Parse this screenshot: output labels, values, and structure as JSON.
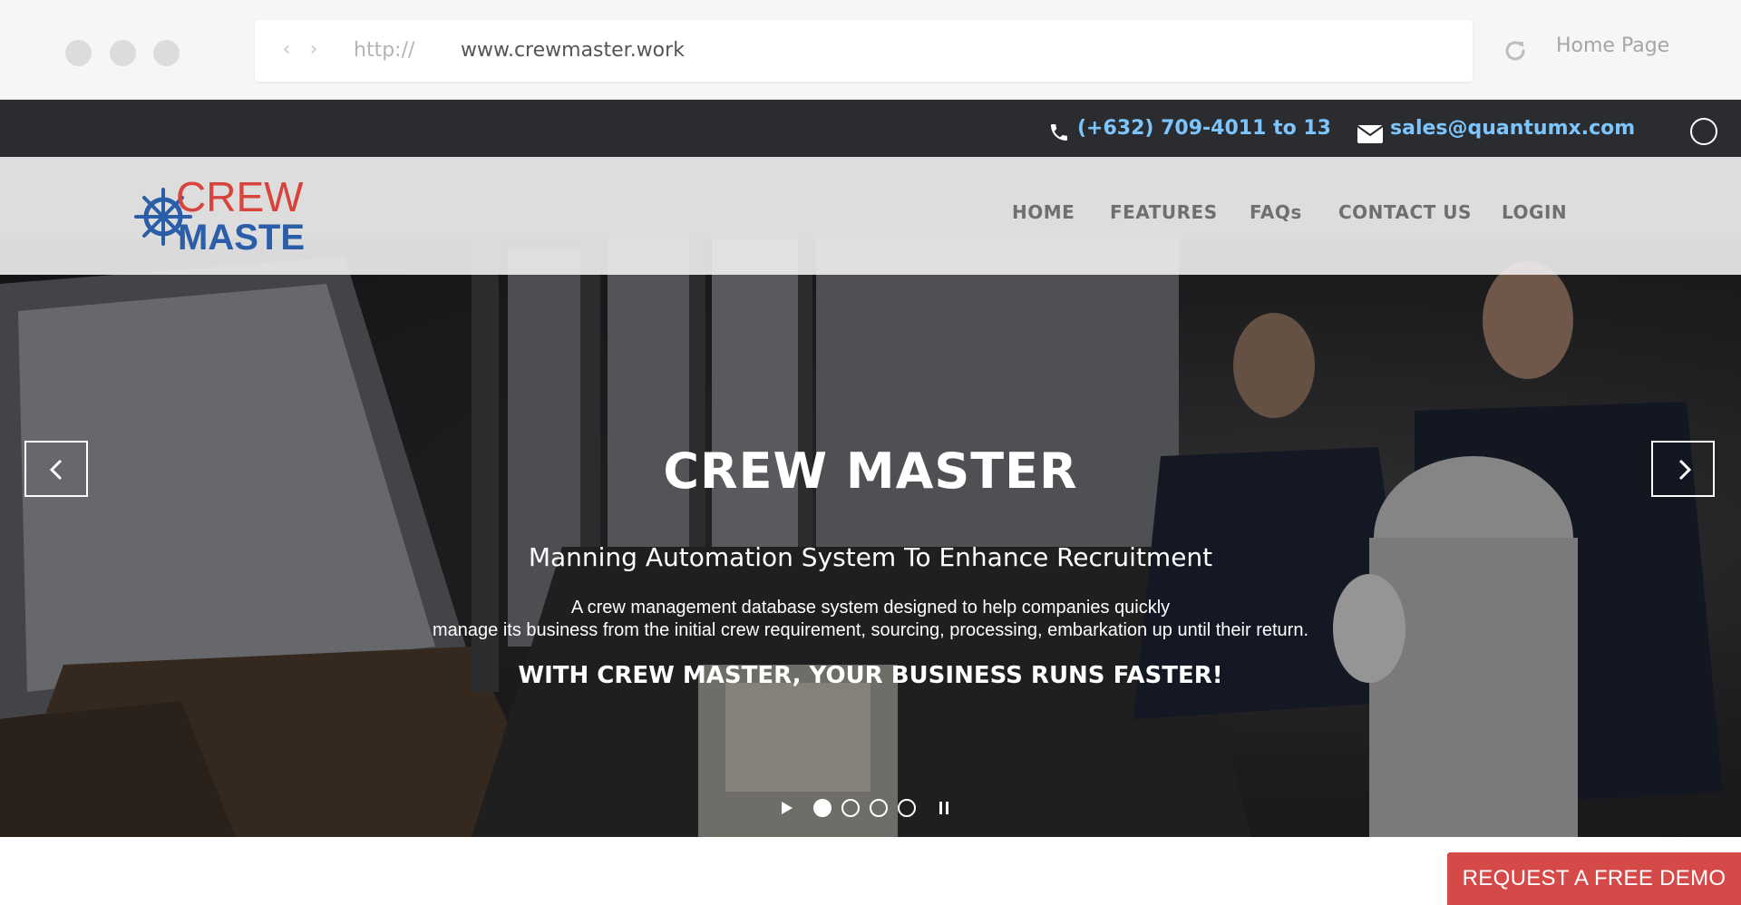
{
  "browser": {
    "protocol": "http://",
    "url": "www.crewmaster.work",
    "home_label": "Home Page"
  },
  "topbar": {
    "phone": "(+632) 709-4011 to 13",
    "email": "sales@quantumx.com"
  },
  "logo": {
    "line1": "CREW",
    "line2": "MASTER"
  },
  "nav": {
    "items": [
      "HOME",
      "FEATURES",
      "FAQs",
      "CONTACT US",
      "LOGIN"
    ]
  },
  "hero": {
    "title": "CREW MASTER",
    "subtitle": "Manning Automation System To Enhance Recruitment",
    "desc_line1": "A crew management database system designed to help companies quickly",
    "desc_line2": "manage its business from the initial crew requirement, sourcing, processing, embarkation up until their return.",
    "tagline": "WITH CREW MASTER, YOUR BUSINESS RUNS FASTER!",
    "slide_count": 4,
    "active_slide": 1
  },
  "cta": {
    "demo_label": "REQUEST A FREE DEMO"
  },
  "colors": {
    "accent_link": "#7cc5ff",
    "cta_red": "#d54a48",
    "logo_red": "#d9433d",
    "logo_blue": "#2a5ea8",
    "topbar_bg": "#2b2c2f"
  }
}
